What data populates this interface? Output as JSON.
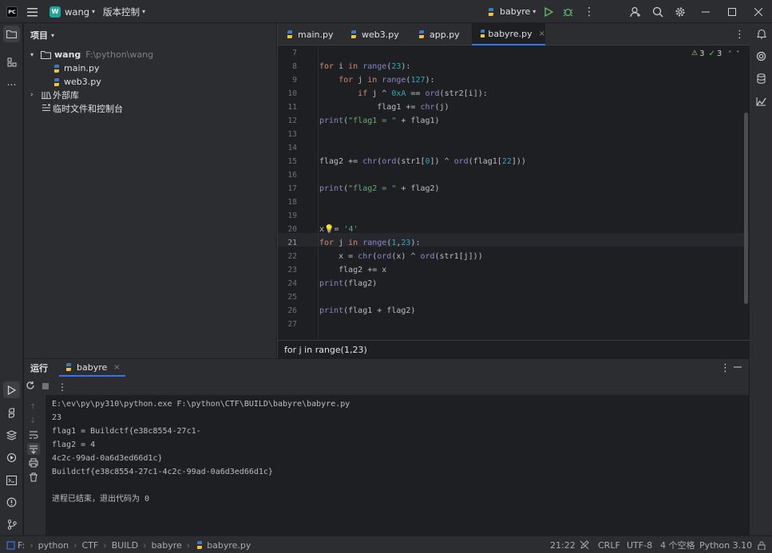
{
  "titlebar": {
    "app_logo": "PC",
    "project_badge": "W",
    "project_name": "wang",
    "vcs_label": "版本控制",
    "run_config": "babyre"
  },
  "project_panel": {
    "title": "项目",
    "root_name": "wang",
    "root_path": "F:\\python\\wang",
    "files": [
      "main.py",
      "web3.py"
    ],
    "external_libs": "外部库",
    "scratches": "临时文件和控制台"
  },
  "editor": {
    "tabs": [
      "main.py",
      "web3.py",
      "app.py",
      "babyre.py"
    ],
    "active_tab": 3,
    "inspections": {
      "warnings": "3",
      "ok": "3"
    },
    "line_numbers": [
      "7",
      "8",
      "9",
      "10",
      "11",
      "12",
      "13",
      "14",
      "15",
      "16",
      "17",
      "18",
      "19",
      "20",
      "21",
      "22",
      "23",
      "24",
      "25",
      "26",
      "27"
    ],
    "current_line": "21",
    "breadcrumb": "for j in range(1,23)"
  },
  "run_panel": {
    "title": "运行",
    "tab": "babyre",
    "output": [
      "E:\\ev\\py\\py310\\python.exe F:\\python\\CTF\\BUILD\\babyre\\babyre.py",
      "23",
      "flag1 = Buildctf{e38c8554-27c1-",
      "flag2 = 4",
      "4c2c-99ad-0a6d3ed66d1c}",
      "Buildctf{e38c8554-27c1-4c2c-99ad-0a6d3ed66d1c}",
      "",
      "进程已结束，退出代码为 0"
    ]
  },
  "statusbar": {
    "path": [
      "F:",
      "python",
      "CTF",
      "BUILD",
      "babyre",
      "babyre.py"
    ],
    "position": "21:22",
    "line_sep": "CRLF",
    "encoding": "UTF-8",
    "indent": "4 个空格",
    "interpreter": "Python 3.10"
  },
  "colors": {
    "accent": "#3574f0",
    "run_green": "#5fb865",
    "background": "#1e1f22",
    "panel": "#2b2d30"
  }
}
